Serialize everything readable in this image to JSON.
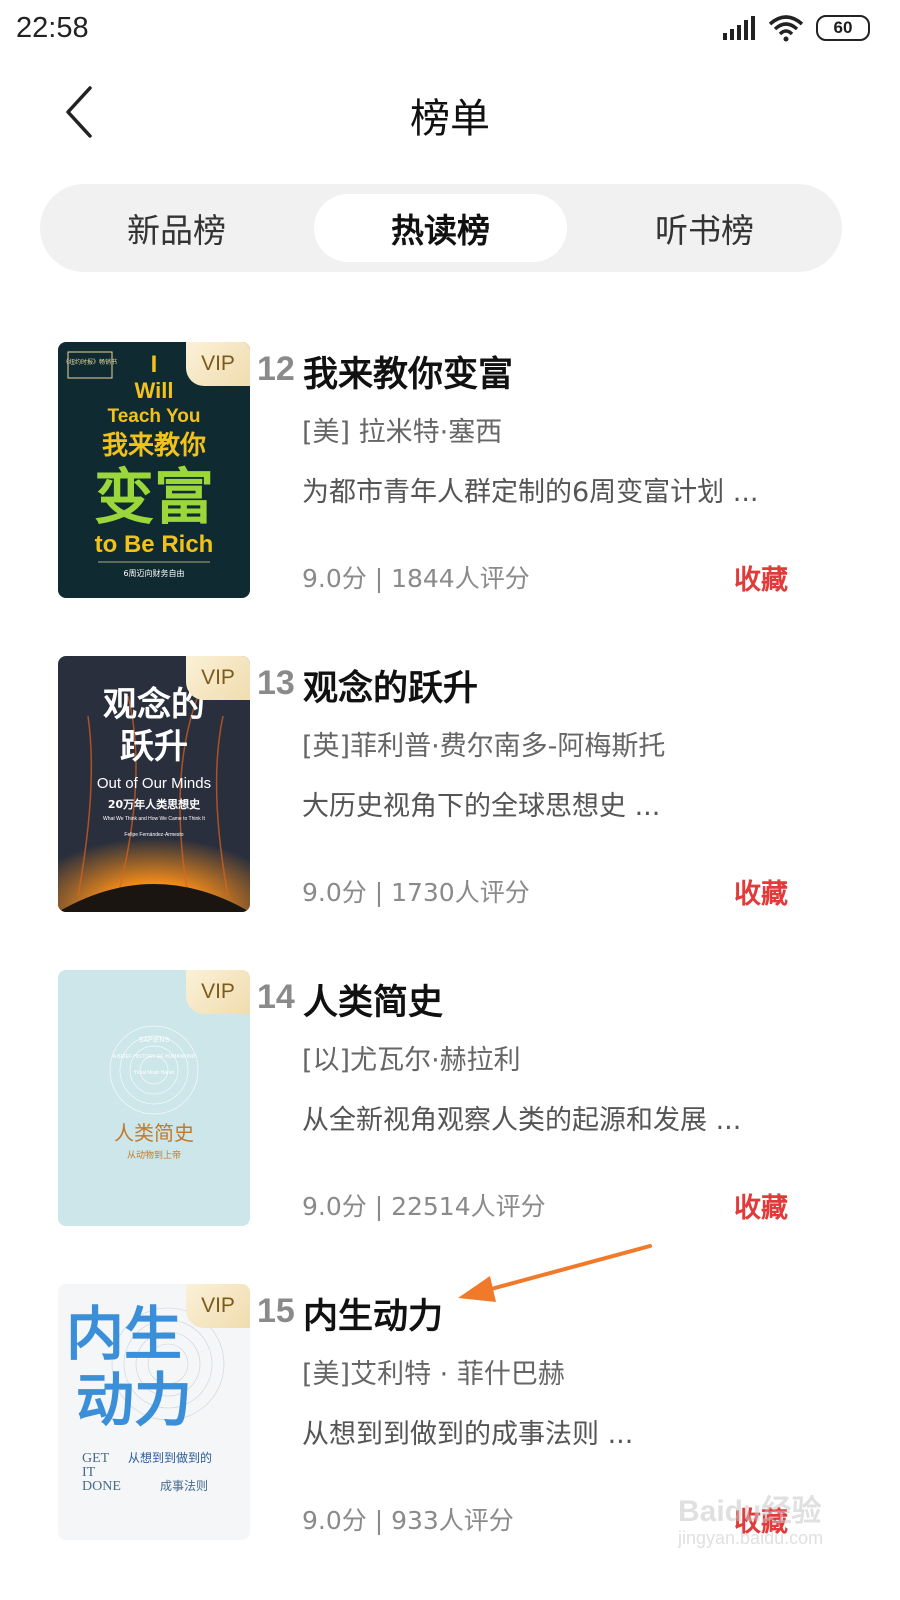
{
  "status_bar": {
    "time": "22:58",
    "battery": "60"
  },
  "header": {
    "title": "榜单"
  },
  "tabs": [
    {
      "label": "新品榜",
      "active": false
    },
    {
      "label": "热读榜",
      "active": true
    },
    {
      "label": "听书榜",
      "active": false
    }
  ],
  "books": [
    {
      "rank": "12",
      "title": "我来教你变富",
      "author": "[美] 拉米特·塞西",
      "desc": "为都市青年人群定制的6周变富计划 ...",
      "rating": "9.0分 | 1844人评分",
      "fav_label": "收藏",
      "badge": "VIP",
      "cover": {
        "top": "《纽约时报》畅销书",
        "l1": "I",
        "l2": "Will",
        "l3": "Teach You",
        "zh1": "我来教你",
        "zh2": "变富",
        "en": "to Be Rich",
        "sub": "6周迈向财务自由"
      }
    },
    {
      "rank": "13",
      "title": "观念的跃升",
      "author": "[英]菲利普·费尔南多-阿梅斯托",
      "desc": "大历史视角下的全球思想史 ...",
      "rating": "9.0分 | 1730人评分",
      "fav_label": "收藏",
      "badge": "VIP",
      "cover": {
        "zh1": "观念的",
        "zh2": "跃升",
        "en": "Out of Our Minds",
        "sub": "20万年人类思想史",
        "sub2": "What We Think and How We Came to Think It",
        "author": "Felipe Fernández-Armesto"
      }
    },
    {
      "rank": "14",
      "title": "人类简史",
      "author": "[以]尤瓦尔·赫拉利",
      "desc": "从全新视角观察人类的起源和发展 ...",
      "rating": "9.0分 | 22514人评分",
      "fav_label": "收藏",
      "badge": "VIP",
      "cover": {
        "en": "SAPIENS",
        "en2": "A BRIEF HISTORY OF HUMANKIND",
        "en3": "Yuval Noah Harari",
        "zh1": "人类简史",
        "zh2": "从动物到上帝"
      }
    },
    {
      "rank": "15",
      "title": "内生动力",
      "author": "[美]艾利特 · 菲什巴赫",
      "desc": "从想到到做到的成事法则 ...",
      "rating": "9.0分 | 933人评分",
      "fav_label": "收藏",
      "badge": "VIP",
      "cover": {
        "zh1": "内生",
        "zh2": "动力",
        "en1": "GET",
        "en2": "IT",
        "en3": "DONE",
        "zh3": "从想到到做到的",
        "zh4": "成事法则"
      }
    }
  ],
  "watermark": {
    "brand": "Baidu经验",
    "url": "jingyan.baidu.com"
  },
  "colors": {
    "favorite": "#e23a3a",
    "vip_text": "#7b5b1c",
    "tab_bg": "#f1f1f1",
    "annotation_arrow": "#f07a2a"
  }
}
